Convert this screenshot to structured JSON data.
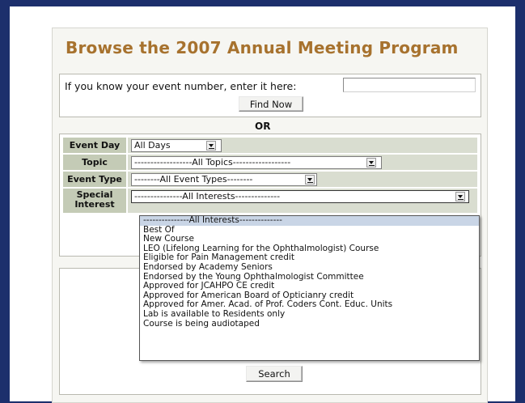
{
  "title": "Browse the 2007 Annual Meeting Program",
  "find": {
    "label": "If you know your event number, enter it here:",
    "input_value": "",
    "button": "Find Now"
  },
  "or_label": "OR",
  "filters": {
    "event_day": {
      "label": "Event Day",
      "value": "All Days"
    },
    "topic": {
      "label": "Topic",
      "value": "------------------All Topics------------------"
    },
    "event_type": {
      "label": "Event Type",
      "value": "--------All Event Types--------"
    },
    "special_interest": {
      "label_1": "Special",
      "label_2": "Interest",
      "value": "---------------All Interests--------------"
    }
  },
  "dropdown_options": [
    "---------------All Interests--------------",
    "Best Of",
    "New Course",
    "LEO (Lifelong Learning for the Ophthalmologist) Course",
    "Eligible for Pain Management credit",
    "Endorsed by Academy Seniors",
    "Endorsed by the Young Ophthalmologist Committee",
    "Approved for JCAHPO CE credit",
    "Approved for American Board of Opticianry credit",
    "Approved for Amer. Acad. of Prof. Coders Cont. Educ. Units",
    "Lab is available to Residents only",
    "Course is being audiotaped"
  ],
  "search_button": "Search",
  "colors": {
    "border": "#1c2f6c",
    "title": "#a7722e",
    "label_bg": "#c4cbb6",
    "cell_bg": "#d9ddd0"
  },
  "icons": [
    "dropdown-arrow-icon"
  ]
}
